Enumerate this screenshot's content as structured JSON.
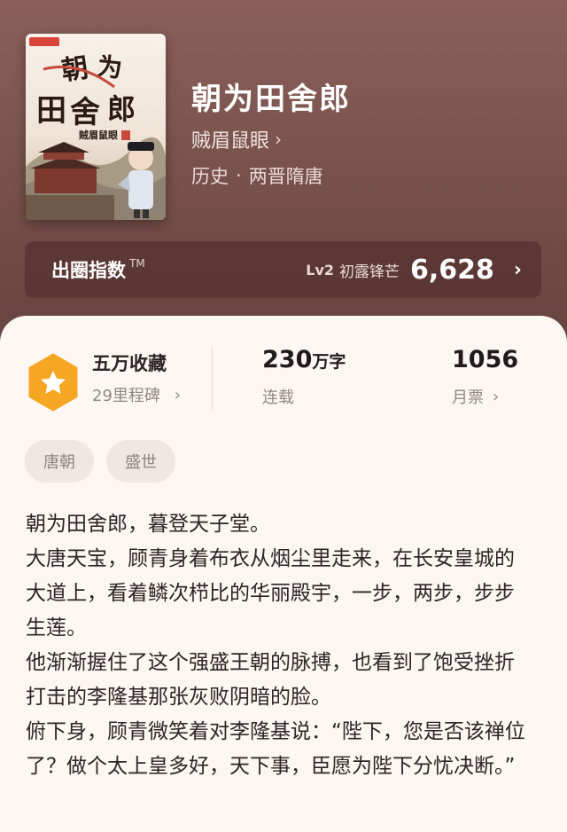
{
  "book": {
    "title": "朝为田舍郎",
    "author": "贼眉鼠眼",
    "genre": "历史",
    "genre_sep": "·",
    "subgenre": "两晋隋唐",
    "cover": {
      "title_chars": "朝为田舍郎",
      "author": "贼眉鼠眼"
    }
  },
  "index_bar": {
    "label": "出圈指数",
    "tm": "TM",
    "level": "Lv2",
    "rank": "初露锋芒",
    "value": "6,628",
    "chevron": "chevron-right-icon"
  },
  "stats": {
    "collection_title": "五万收藏",
    "collection_sub": "29里程碑",
    "word_count": "230",
    "word_unit": "万字",
    "status": "连载",
    "monthly_votes": "1056",
    "monthly_label": "月票",
    "badge_icon": "star-badge-icon",
    "badge_color": "#f5a623"
  },
  "tags": [
    "唐朝",
    "盛世"
  ],
  "description": [
    "朝为田舍郎，暮登天子堂。",
    "大唐天宝，顾青身着布衣从烟尘里走来，在长安皇城的大道上，看着鳞次栉比的华丽殿宇，一步，两步，步步生莲。",
    "他渐渐握住了这个强盛王朝的脉搏，也看到了饱受挫折打击的李隆基那张灰败阴暗的脸。",
    "俯下身，顾青微笑着对李隆基说：“陛下，您是否该禅位了？做个太上皇多好，天下事，臣愿为陛下分忧决断。”"
  ]
}
